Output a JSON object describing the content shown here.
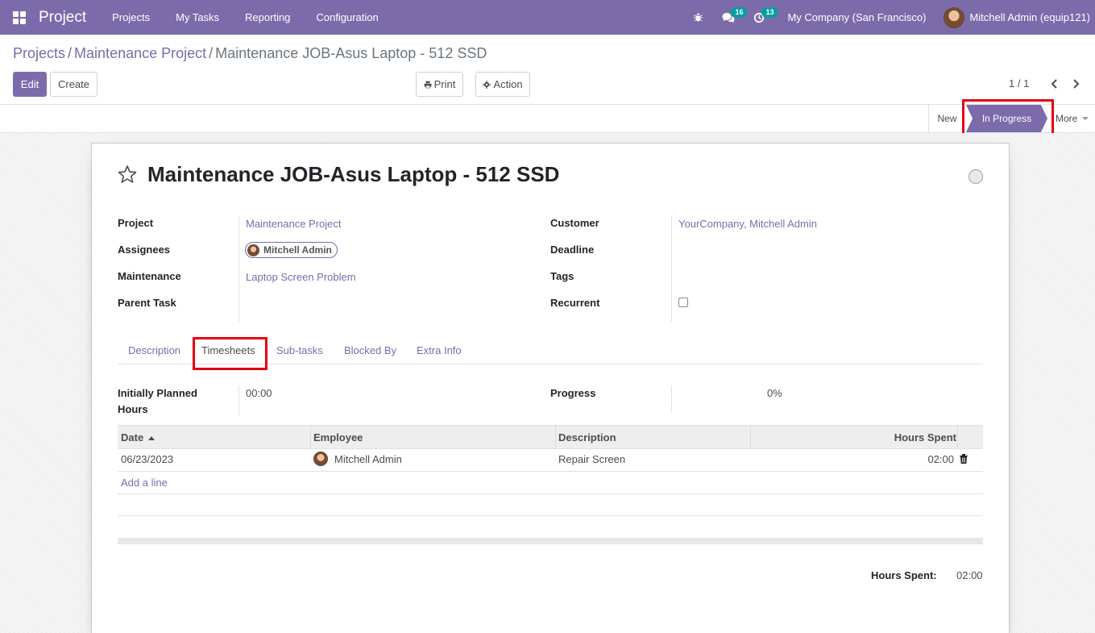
{
  "navbar": {
    "app_name": "Project",
    "menu": [
      "Projects",
      "My Tasks",
      "Reporting",
      "Configuration"
    ],
    "messages_count": "16",
    "activities_count": "13",
    "company": "My Company (San Francisco)",
    "user": "Mitchell Admin (equip121)"
  },
  "breadcrumb": {
    "items": [
      "Projects",
      "Maintenance Project"
    ],
    "current": "Maintenance JOB-Asus Laptop - 512 SSD",
    "sep": "/"
  },
  "toolbar": {
    "edit": "Edit",
    "create": "Create",
    "print": "Print",
    "action": "Action",
    "pager": "1 / 1"
  },
  "statusbar": {
    "stages": [
      "New",
      "In Progress"
    ],
    "current": "In Progress",
    "more": "More"
  },
  "form": {
    "title": "Maintenance JOB-Asus Laptop - 512 SSD",
    "labels": {
      "project": "Project",
      "assignees": "Assignees",
      "maintenance": "Maintenance",
      "parent_task": "Parent Task",
      "customer": "Customer",
      "deadline": "Deadline",
      "tags": "Tags",
      "recurrent": "Recurrent"
    },
    "values": {
      "project": "Maintenance Project",
      "assignee": "Mitchell Admin",
      "maintenance": "Laptop Screen Problem",
      "customer": "YourCompany, Mitchell Admin",
      "recurrent_checked": false
    }
  },
  "tabs": [
    "Description",
    "Timesheets",
    "Sub-tasks",
    "Blocked By",
    "Extra Info"
  ],
  "active_tab": "Timesheets",
  "timesheets": {
    "planned_label_1": "Initially Planned",
    "planned_label_2": "Hours",
    "planned_value": "00:00",
    "progress_label": "Progress",
    "progress_value": "0%",
    "columns": [
      "Date",
      "Employee",
      "Description",
      "Hours Spent"
    ],
    "rows": [
      {
        "date": "06/23/2023",
        "employee": "Mitchell Admin",
        "description": "Repair Screen",
        "hours": "02:00"
      }
    ],
    "add_line": "Add a line",
    "total_label": "Hours Spent:",
    "total_value": "02:00"
  },
  "colors": {
    "brand": "#7c6bab",
    "highlight": "#e4000f"
  }
}
